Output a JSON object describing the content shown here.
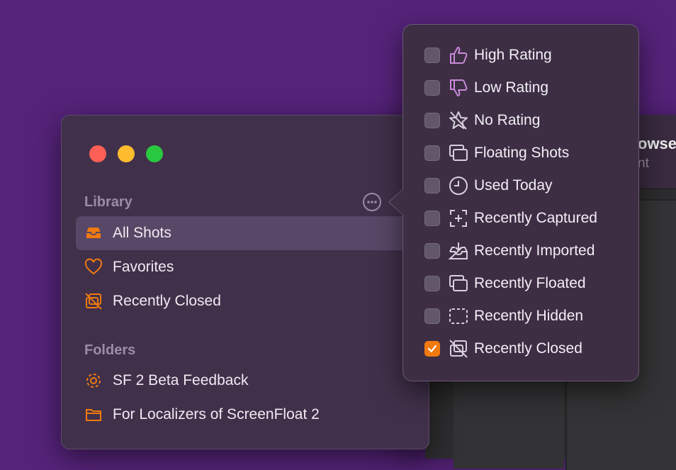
{
  "main_window": {
    "title": "owse",
    "subtitle": "nt"
  },
  "sidebar": {
    "library_header": "Library",
    "folders_header": "Folders",
    "library_items": [
      {
        "label": "All Shots",
        "icon": "tray-icon",
        "selected": true
      },
      {
        "label": "Favorites",
        "icon": "heart-icon",
        "selected": false
      },
      {
        "label": "Recently Closed",
        "icon": "closed-window-icon",
        "selected": false
      }
    ],
    "folder_items": [
      {
        "label": "SF 2 Beta Feedback",
        "icon": "gear-icon"
      },
      {
        "label": "For Localizers of ScreenFloat 2",
        "icon": "folder-icon"
      }
    ]
  },
  "popover": {
    "items": [
      {
        "label": "High Rating",
        "icon": "thumbs-up-icon",
        "checked": false
      },
      {
        "label": "Low Rating",
        "icon": "thumbs-down-icon",
        "checked": false
      },
      {
        "label": "No Rating",
        "icon": "star-slash-icon",
        "checked": false
      },
      {
        "label": "Floating Shots",
        "icon": "stacked-windows-icon",
        "checked": false
      },
      {
        "label": "Used Today",
        "icon": "clock-icon",
        "checked": false
      },
      {
        "label": "Recently Captured",
        "icon": "capture-plus-icon",
        "checked": false
      },
      {
        "label": "Recently Imported",
        "icon": "tray-download-icon",
        "checked": false
      },
      {
        "label": "Recently Floated",
        "icon": "stacked-windows-icon",
        "checked": false
      },
      {
        "label": "Recently Hidden",
        "icon": "dashed-rect-icon",
        "checked": false
      },
      {
        "label": "Recently Closed",
        "icon": "closed-window-icon",
        "checked": true
      }
    ]
  },
  "colors": {
    "accent": "#f07a0f",
    "background": "#55237a"
  }
}
